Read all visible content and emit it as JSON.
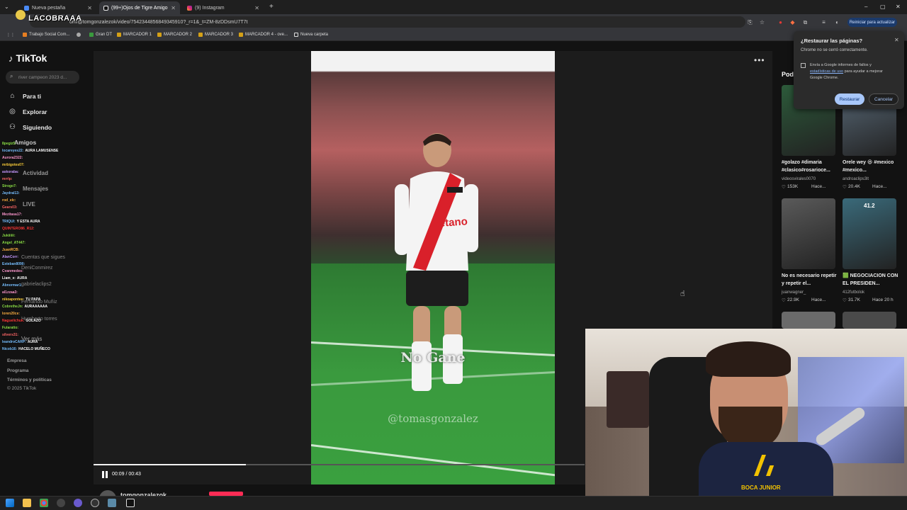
{
  "tabs": [
    {
      "title": "Nueva pestaña",
      "active": false,
      "icon": "chrome-icon"
    },
    {
      "title": "(99+)Ojos de Tigre Amigo",
      "active": true,
      "icon": "tiktok-icon"
    },
    {
      "title": "(9) Instagram",
      "active": false,
      "icon": "instagram-icon"
    }
  ],
  "url": "om/@tomgonzalezok/video/7542344856849345910?_r=1&_t=ZM-8zDDsmU7T7t",
  "update_button": "Reiniciar para actualizar",
  "bookmarks": [
    "Trabajo Social Com...",
    "Gran DT",
    "MARCADOR 1",
    "MARCADOR 2",
    "MARCADOR 3",
    "MARCADOR 4 - ove...",
    "Nueva carpeta"
  ],
  "stream_overlay_name": "LACOBRAAA",
  "sidebar": {
    "logo": "TikTok",
    "search_placeholder": "river campeon 2023 d...",
    "nav": [
      "Para ti",
      "Explorar",
      "Siguiendo",
      "Amigos",
      "Actividad",
      "Mensajes",
      "LIVE"
    ],
    "following_header": "Cuentas que sigues",
    "following": [
      "DeniConmirez",
      "gabrielaclips2",
      "Fernando Muñiz",
      "Humberto torres"
    ],
    "see_more": "Ver más",
    "footer": [
      "Empresa",
      "Programa",
      "Términos y políticas",
      "© 2025 TikTok"
    ]
  },
  "chat": [
    {
      "user": "8pegiz5:",
      "msg": "",
      "color": "#8ee04a"
    },
    {
      "user": "locareyes22:",
      "msg": "AURA LAMUSENSE",
      "color": "#7ac0ff"
    },
    {
      "user": "Aurora2322:",
      "msg": "",
      "color": "#ff9bd0"
    },
    {
      "user": "mrbigotes07:",
      "msg": "",
      "color": "#ffd23f"
    },
    {
      "user": "askoraba:",
      "msg": "",
      "color": "#c89cff"
    },
    {
      "user": "mrrlp:",
      "msg": "",
      "color": "#ff6b6b"
    },
    {
      "user": "Strogo7:",
      "msg": "",
      "color": "#8ee04a"
    },
    {
      "user": "Jaydral13:",
      "msg": "",
      "color": "#7ac0ff"
    },
    {
      "user": "rod_elc:",
      "msg": "",
      "color": "#ffb347"
    },
    {
      "user": "Gears03:",
      "msg": "",
      "color": "#ff6b6b"
    },
    {
      "user": "Mezitasa17:",
      "msg": "",
      "color": "#ff9bd0"
    },
    {
      "user": "TRIQUI:",
      "msg": "Y ESTA AURA",
      "color": "#7ac0ff"
    },
    {
      "user": "QUINTERO86_R12:",
      "msg": "",
      "color": "#ff3b3b"
    },
    {
      "user": "Jukiiiiii:",
      "msg": "",
      "color": "#8ee04a"
    },
    {
      "user": "Angel_AT447:",
      "msg": "",
      "color": "#8ee04a"
    },
    {
      "user": "JuanRCB:",
      "msg": "",
      "color": "#ffb347"
    },
    {
      "user": "AlanCorr:",
      "msg": "",
      "color": "#c89cff"
    },
    {
      "user": "Esteban8090:",
      "msg": "",
      "color": "#7ac0ff"
    },
    {
      "user": "Cvanmedes:",
      "msg": "",
      "color": "#ff9bd0"
    },
    {
      "user": "Liam_x:",
      "msg": "AURA",
      "color": "#ffffff"
    },
    {
      "user": "Abnormar1:",
      "msg": "",
      "color": "#7ac0ff"
    },
    {
      "user": "al1zzaa3:",
      "msg": "",
      "color": "#ff9bd0"
    },
    {
      "user": "nikoapontee:",
      "msg": "TU PAPA",
      "color": "#ffd23f"
    },
    {
      "user": "CobretheJn:",
      "msg": "AURAAAAAA",
      "color": "#8ee04a"
    },
    {
      "user": "loren20ce:",
      "msg": "",
      "color": "#ffb347"
    },
    {
      "user": "Naguelichuk:",
      "msg": "GOLAZO",
      "color": "#ff3b3b"
    },
    {
      "user": "Fularatto:",
      "msg": "",
      "color": "#8ee04a"
    },
    {
      "user": "silvers31:",
      "msg": "",
      "color": "#ff6b6b"
    },
    {
      "user": "leandroCARP:",
      "msg": "AURA",
      "color": "#7ac0ff"
    },
    {
      "user": "Nicob16:",
      "msg": "HACELO MUÑECO",
      "color": "#7ac0ff"
    }
  ],
  "video": {
    "caption": "No Gane",
    "watermark": "@tomasgonzalez",
    "time": "00:09 / 00:43",
    "progress": 0.31,
    "author": "tomgonzalezok",
    "jersey_sponsor": "Betano"
  },
  "right_panel": {
    "title": "Pod",
    "cards": [
      {
        "caption": "#golazo #dimaria #clasico#rosarioce...",
        "user": "videosvirales0070",
        "likes": "153K",
        "time": "Hace...",
        "color": "#2c5a3a"
      },
      {
        "caption": "Orele wey 😆 #mexico #mexico...",
        "user": "androaclips3lt",
        "likes": "20.4K",
        "time": "Hace...",
        "color": "#5a6b7a"
      },
      {
        "caption": "No es necesario repetir y repetir el...",
        "user": "juanwagner_",
        "likes": "22.9K",
        "time": "Hace...",
        "color": "#5a5a5a"
      },
      {
        "caption": "🟩 NEGOCIACION CON EL PRESIDEN...",
        "user": "412futbolok",
        "likes": "31.7K",
        "time": "Hace 20 h",
        "color": "#3a6a7a",
        "badge": "41.2"
      }
    ]
  },
  "restore_dialog": {
    "title": "¿Restaurar las páginas?",
    "subtitle": "Chrome no se cerró correctamente.",
    "checkbox_text_1": "Envía a Google informes de fallos y",
    "checkbox_link": "estadísticas de uso",
    "checkbox_text_2": "para ayudar a mejorar Google Chrome.",
    "restore": "Restaurar",
    "cancel": "Cancelar"
  },
  "webcam": {
    "shirt_text": "BOCA JUNIOR"
  }
}
